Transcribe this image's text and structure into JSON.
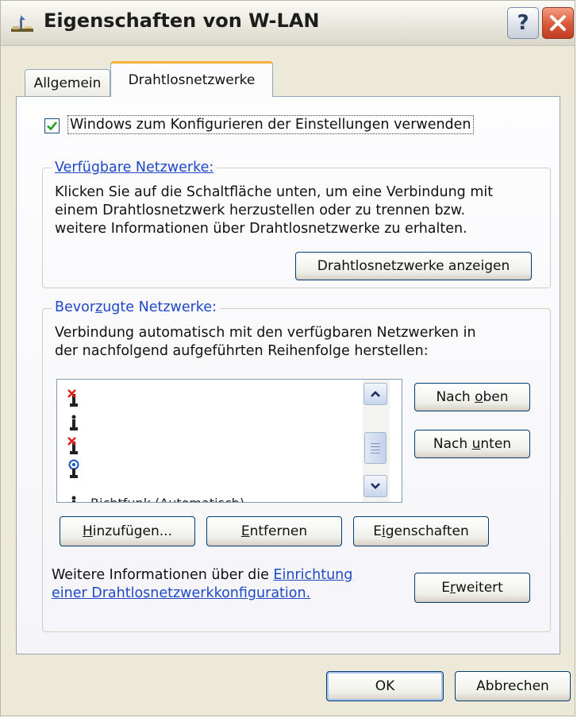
{
  "window": {
    "title": "Eigenschaften von W-LAN",
    "help_label": "?",
    "colors": {
      "accent_tab": "#f0b43c",
      "link": "#1e48c6",
      "close": "#d8573a"
    }
  },
  "tabs": [
    {
      "label": "Allgemein",
      "active": false
    },
    {
      "label": "Drahtlosnetzwerke",
      "active": true
    }
  ],
  "config_checkbox": {
    "checked": true,
    "label": "Windows zum Konfigurieren der Einstellungen verwenden"
  },
  "available": {
    "legend": "Verfügbare Netzwerke:",
    "lines": [
      "Klicken Sie auf die Schaltfläche unten, um eine Verbindung mit",
      "einem Drahtlosnetzwerk herzustellen oder zu trennen bzw.",
      "weitere Informationen über Drahtlosnetzwerke zu erhalten."
    ],
    "show_button": "Drahtlosnetzwerke anzeigen"
  },
  "preferred": {
    "legend_before": "Bevor",
    "legend_accel": "z",
    "legend_after": "ugte Netzwerke:",
    "lines": [
      "Verbindung automatisch mit den verfügbaren Netzwerken in",
      "der nachfolgend aufgeführten Reihenfolge herstellen:"
    ],
    "list_items": [
      {
        "icon": "wireless-network-disabled-icon",
        "name": ""
      },
      {
        "icon": "wireless-network-icon",
        "name": ""
      },
      {
        "icon": "wireless-network-disabled-icon",
        "name": ""
      },
      {
        "icon": "wireless-network-connected-icon",
        "name": ""
      },
      {
        "icon": "wireless-network-icon",
        "name": "Richtfunk (Automatisch)"
      }
    ],
    "move_up": {
      "before": "Nach ",
      "accel": "o",
      "after": "ben"
    },
    "move_down": {
      "before": "Nach ",
      "accel": "u",
      "after": "nten"
    },
    "add": {
      "accel": "H",
      "after": "inzufügen..."
    },
    "remove": {
      "accel": "E",
      "after": "ntfernen"
    },
    "properties": {
      "before": "E",
      "accel": "i",
      "after": "genschaften"
    },
    "info_text": "Weitere Informationen über die ",
    "info_link1": "Einrichtung",
    "info_link2": "einer Drahtlosnetzwerkkonfiguration.",
    "advanced": {
      "before": "E",
      "accel": "r",
      "after": "weitert"
    }
  },
  "footer": {
    "ok": "OK",
    "cancel": "Abbrechen"
  }
}
